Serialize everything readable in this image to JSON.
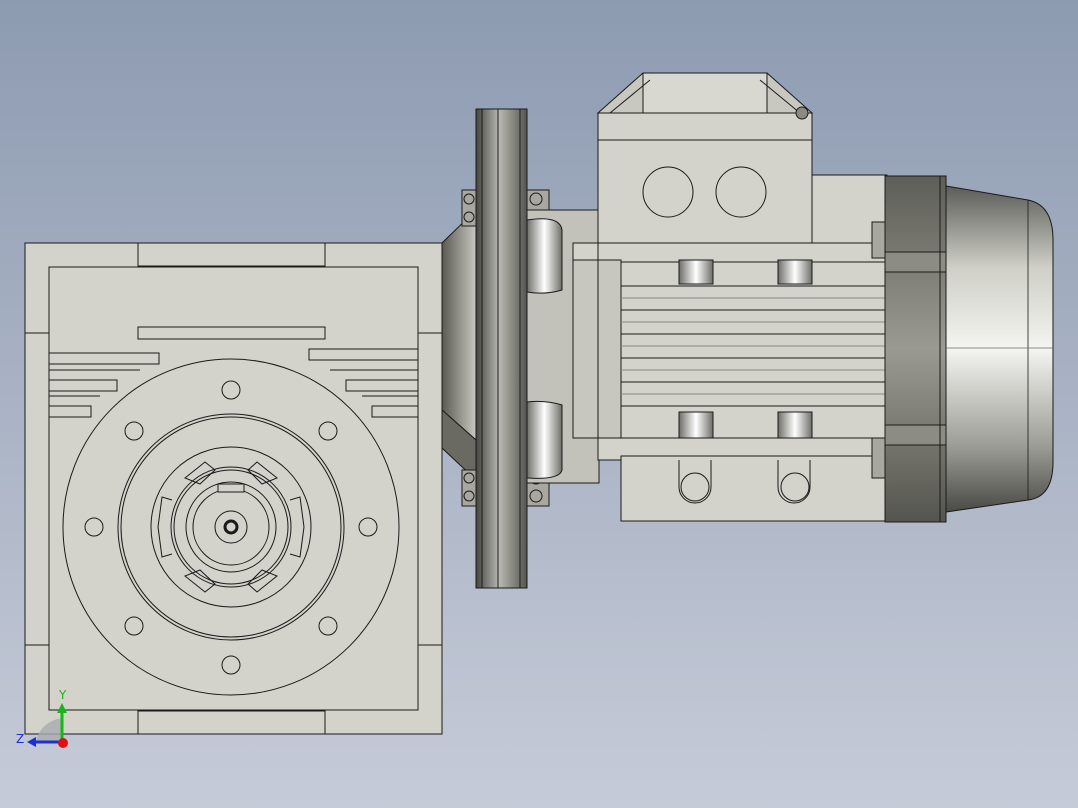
{
  "viewport": {
    "background_top": "#8d9bb1",
    "background_bottom": "#c6cbd8",
    "part_fill": "#d3d2cb",
    "part_stroke": "#1a1a1a"
  },
  "axis_triad": {
    "y_label": "Y",
    "z_label": "Z",
    "y_color": "#16b816",
    "z_color": "#1f2fd6",
    "x_color": "#e01010"
  }
}
